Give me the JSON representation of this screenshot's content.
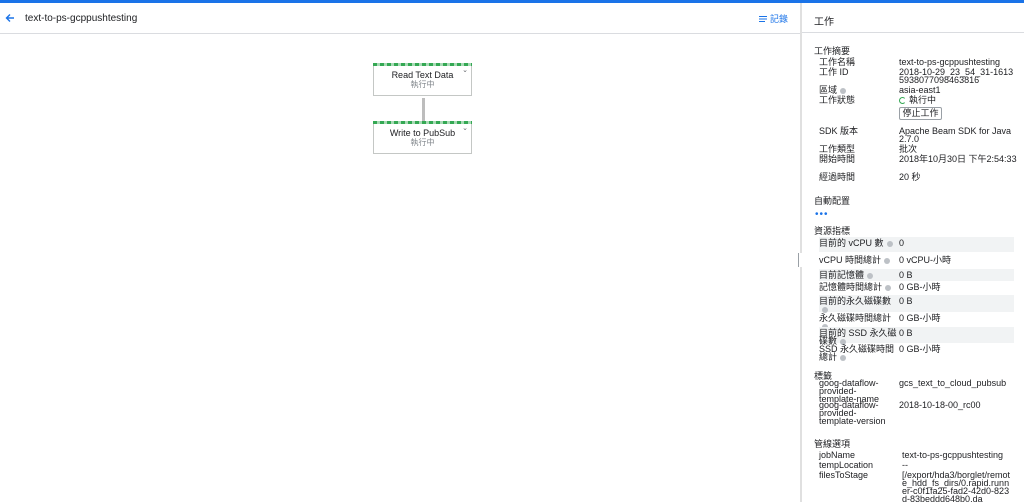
{
  "header": {
    "job_title": "text-to-ps-gcppushtesting",
    "logs_label": "記錄"
  },
  "graph": {
    "nodes": [
      {
        "title": "Read Text Data",
        "status": "執行中"
      },
      {
        "title": "Write to PubSub",
        "status": "執行中"
      }
    ]
  },
  "panel": {
    "title": "工作",
    "summary": {
      "title": "工作摘要",
      "job_name_label": "工作名稱",
      "job_name": "text-to-ps-gcppushtesting",
      "job_id_label": "工作 ID",
      "job_id": "2018-10-29_23_54_31-16135938077098463816",
      "region_label": "區域",
      "region": "asia-east1",
      "status_label": "工作狀態",
      "status": "執行中",
      "stop_label": "停止工作",
      "sdk_label": "SDK 版本",
      "sdk": "Apache Beam SDK for Java 2.7.0",
      "type_label": "工作類型",
      "type": "批次",
      "start_label": "開始時間",
      "start": "2018年10月30日 下午2:54:33",
      "elapsed_label": "經過時間",
      "elapsed": "20 秒"
    },
    "autoscale_title": "自動配置",
    "metrics": {
      "title": "資源指標",
      "rows": [
        {
          "k": "目前的 vCPU 數",
          "v": "0"
        },
        {
          "k": "vCPU 時間總計",
          "v": "0 vCPU-小時"
        },
        {
          "k": "目前記憶體",
          "v": "0 B"
        },
        {
          "k": "記憶體時間總計",
          "v": "0 GB-小時"
        },
        {
          "k": "目前的永久磁碟數",
          "v": "0 B"
        },
        {
          "k": "永久磁碟時間總計",
          "v": "0 GB-小時"
        },
        {
          "k": "目前的 SSD 永久磁碟數",
          "v": "0 B"
        },
        {
          "k": "SSD 永久磁碟時間總計",
          "v": "0 GB-小時"
        }
      ]
    },
    "labels": {
      "title": "標籤",
      "rows": [
        {
          "k": "goog-dataflow-provided-template-name",
          "v": "gcs_text_to_cloud_pubsub"
        },
        {
          "k": "goog-dataflow-provided-template-version",
          "v": "2018-10-18-00_rc00"
        }
      ]
    },
    "pipeline": {
      "title": "管線選項",
      "rows": [
        {
          "k": "jobName",
          "v": "text-to-ps-gcppushtesting"
        },
        {
          "k": "tempLocation",
          "v": "--"
        },
        {
          "k": "filesToStage",
          "v": "[/export/hda3/borglet/remote_hdd_fs_dirs/0.rapid.runner-c0f1fa25-fad2-42d0-823d-83beddd648b0.da"
        }
      ]
    }
  }
}
